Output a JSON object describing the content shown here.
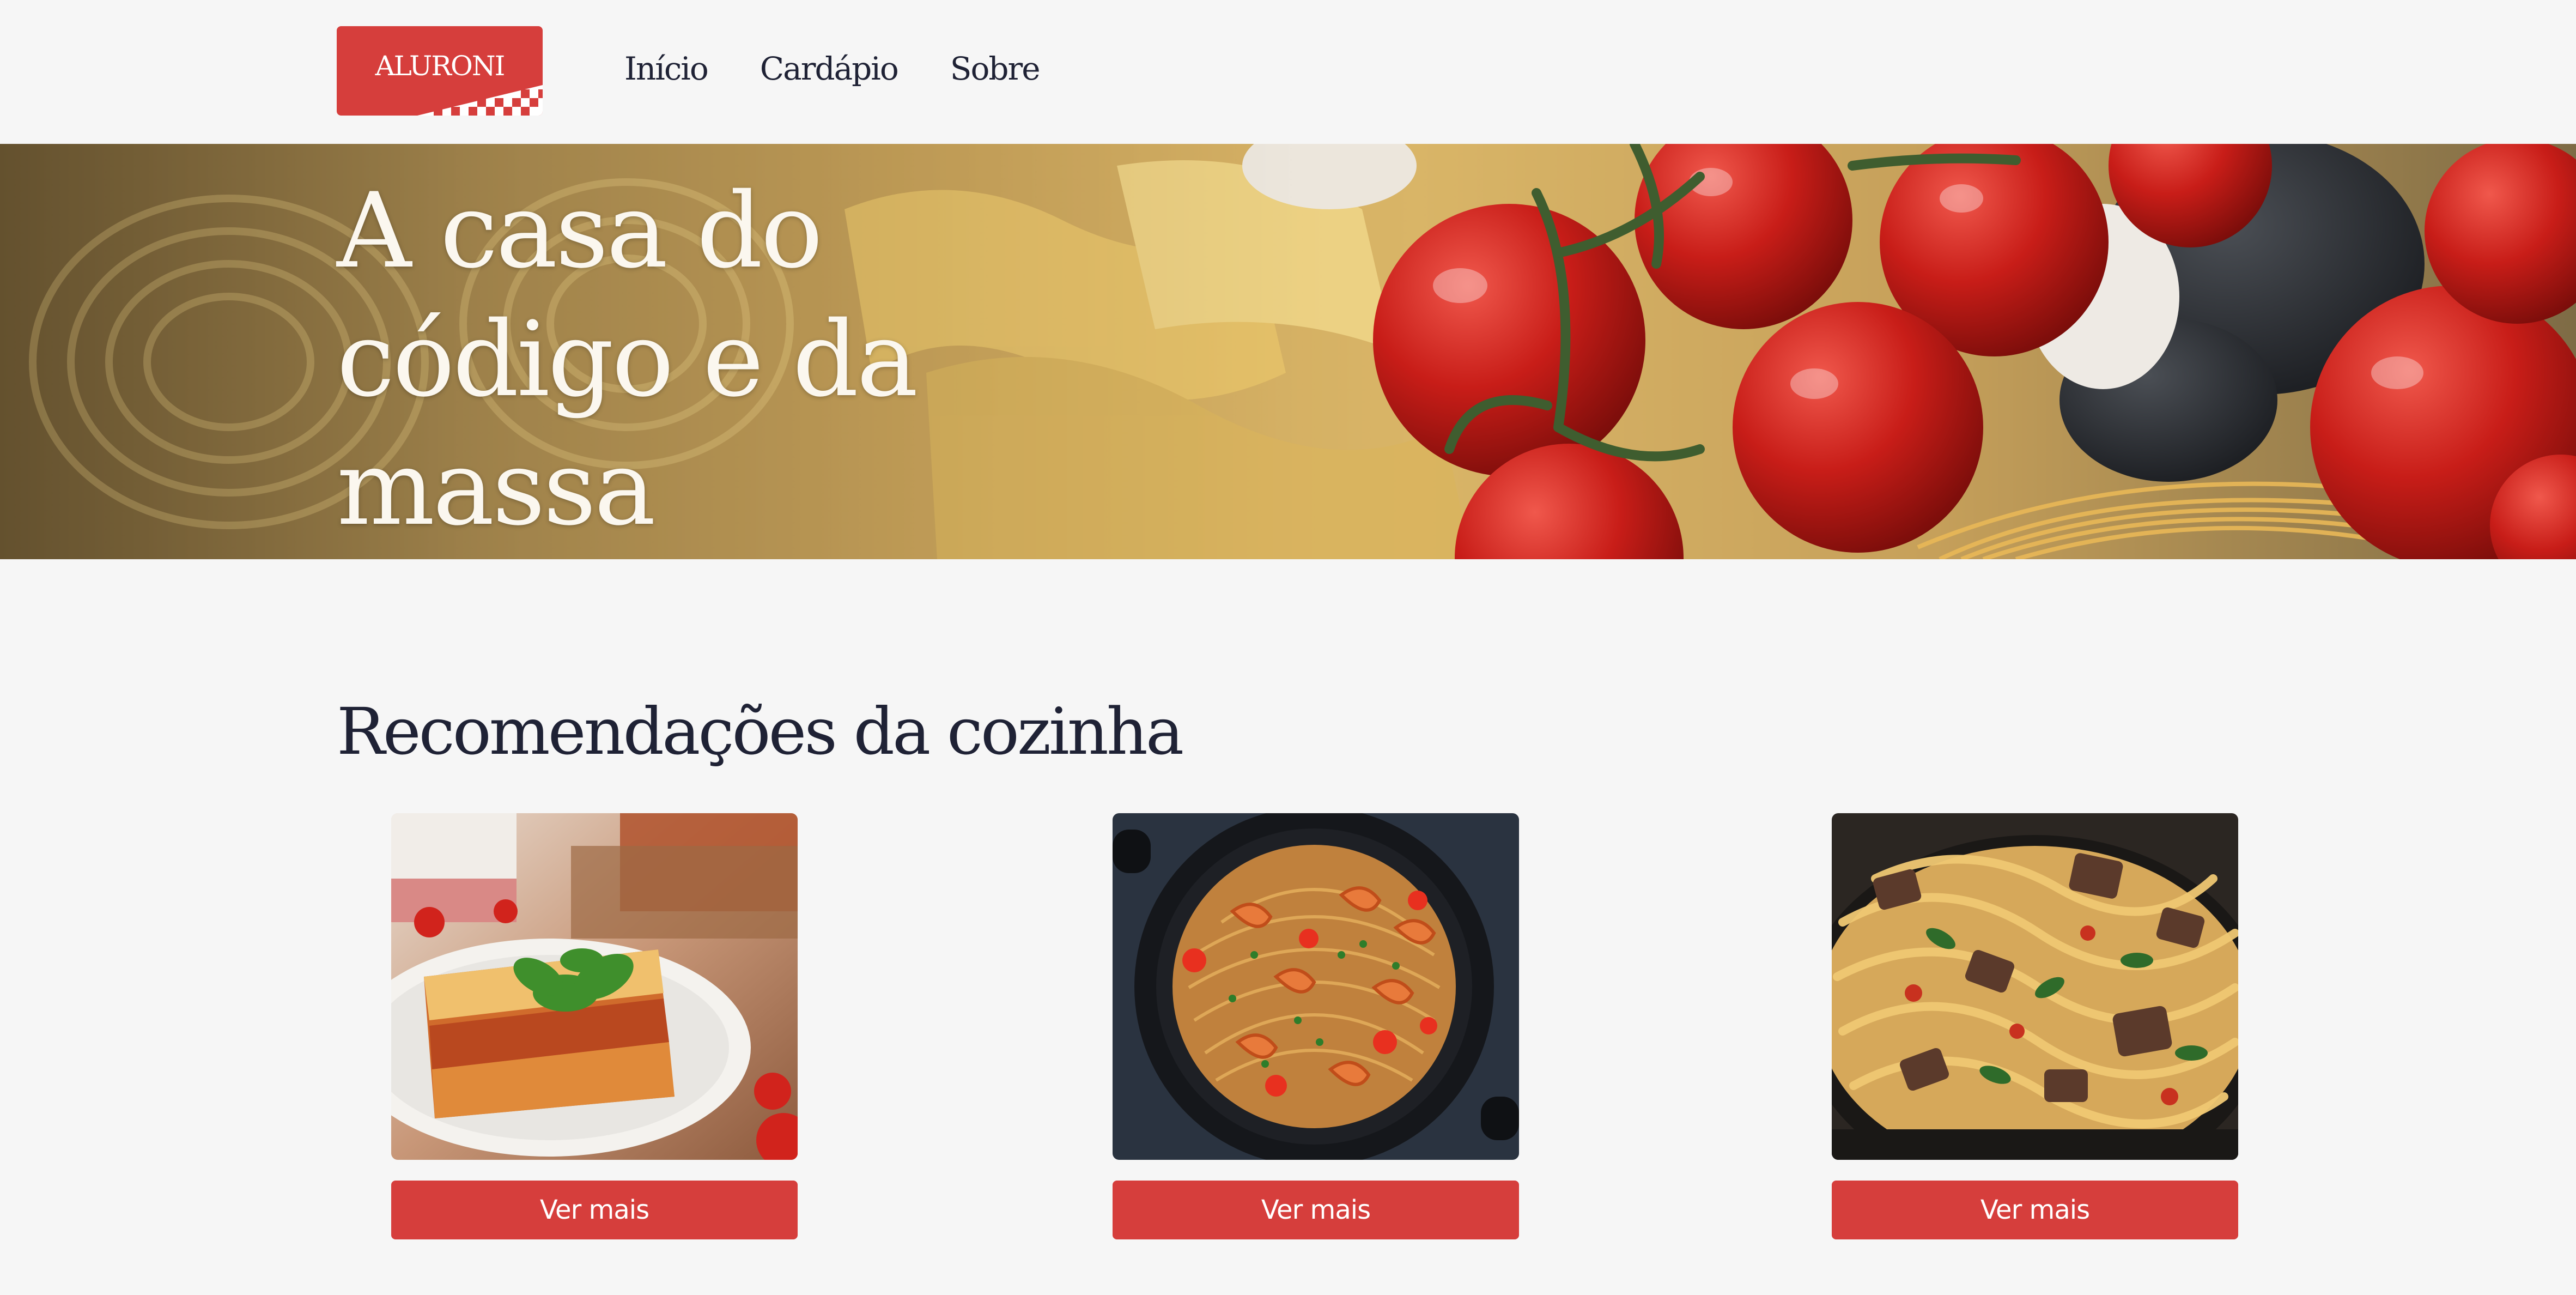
{
  "header": {
    "logo_text": "ALURONI",
    "nav": [
      {
        "label": "Início"
      },
      {
        "label": "Cardápio"
      },
      {
        "label": "Sobre"
      }
    ]
  },
  "hero": {
    "title": "A casa do código e da massa"
  },
  "recommendations": {
    "title": "Recomendações da cozinha",
    "items": [
      {
        "image": "lasagna-photo",
        "button_label": "Ver mais"
      },
      {
        "image": "shrimp-spaghetti-photo",
        "button_label": "Ver mais"
      },
      {
        "image": "beef-fettuccine-photo",
        "button_label": "Ver mais"
      }
    ]
  },
  "colors": {
    "accent": "#d63e3c",
    "background": "#f6f6f6",
    "text": "#1f2235"
  }
}
